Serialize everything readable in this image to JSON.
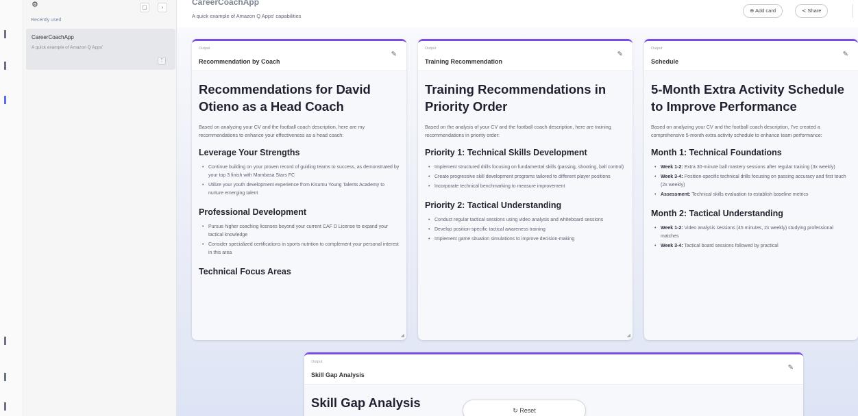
{
  "rail": {
    "items": [
      "",
      "",
      "",
      "",
      "",
      ""
    ],
    "bottom_items": [
      "",
      "",
      ""
    ]
  },
  "sidebar": {
    "logo_text": "",
    "recently_used_label": "Recently used",
    "apps": [
      {
        "name": "CareerCoachApp",
        "description": "A quick example of Amazon Q Apps'"
      }
    ]
  },
  "header": {
    "title": "CareerCoachApp",
    "subtitle": "A quick example of Amazon Q Apps' capabilities",
    "add_card_label": "Add card",
    "share_label": "Share"
  },
  "cards": {
    "coach": {
      "kind": "Output",
      "label": "Recommendation by Coach",
      "heading": "Recommendations for David Otieno as a Head Coach",
      "intro": "Based on analyzing your CV and the football coach description, here are my recommendations to enhance your effectiveness as a head coach:",
      "s1_title": "Leverage Your Strengths",
      "s1_items": [
        "Continue building on your proven record of guiding teams to success, as demonstrated by your top 3 finish with Mambasa Stars FC",
        "Utilize your youth development experience from Kisumu Young Talents Academy to nurture emerging talent"
      ],
      "s2_title": "Professional Development",
      "s2_items": [
        "Pursue higher coaching licenses beyond your current CAF D License to expand your tactical knowledge",
        "Consider specialized certifications in sports nutrition to complement your personal interest in this area"
      ],
      "s3_title": "Technical Focus Areas"
    },
    "training": {
      "kind": "Output",
      "label": "Training Recommendation",
      "heading": "Training Recommendations in Priority Order",
      "intro": "Based on the analysis of your CV and the football coach description, here are training recommendations in priority order:",
      "s1_title": "Priority 1: Technical Skills Development",
      "s1_items": [
        "Implement structured drills focusing on fundamental skills (passing, shooting, ball control)",
        "Create progressive skill development programs tailored to different player positions",
        "Incorporate technical benchmarking to measure improvement"
      ],
      "s2_title": "Priority 2: Tactical Understanding",
      "s2_items": [
        "Conduct regular tactical sessions using video analysis and whiteboard sessions",
        "Develop position-specific tactical awareness training",
        "Implement game situation simulations to improve decision-making"
      ]
    },
    "schedule": {
      "kind": "Output",
      "label": "Schedule",
      "heading": "5-Month Extra Activity Schedule to Improve Performance",
      "intro": "Based on analyzing your CV and the football coach description, I've created a comprehensive 5-month extra activity schedule to enhance team performance:",
      "m1_title": "Month 1: Technical Foundations",
      "m1_items": [
        {
          "bold": "Week 1-2:",
          "text": " Extra 30-minute ball mastery sessions after regular training (3x weekly)"
        },
        {
          "bold": "Week 3-4:",
          "text": " Position-specific technical drills focusing on passing accuracy and first touch (2x weekly)"
        },
        {
          "bold": "Assessment:",
          "text": " Technical skills evaluation to establish baseline metrics"
        }
      ],
      "m2_title": "Month 2: Tactical Understanding",
      "m2_items": [
        {
          "bold": "Week 1-2:",
          "text": " Video analysis sessions (45 minutes, 2x weekly) studying professional matches"
        },
        {
          "bold": "Week 3-4:",
          "text": " Tactical board sessions followed by practical"
        }
      ]
    },
    "skillgap": {
      "kind": "Output",
      "label": "Skill Gap Analysis",
      "heading": "Skill Gap Analysis"
    }
  },
  "reset_label": "Reset",
  "colors": {
    "accent": "#7b4ce0",
    "background": "#e9ecf7"
  }
}
